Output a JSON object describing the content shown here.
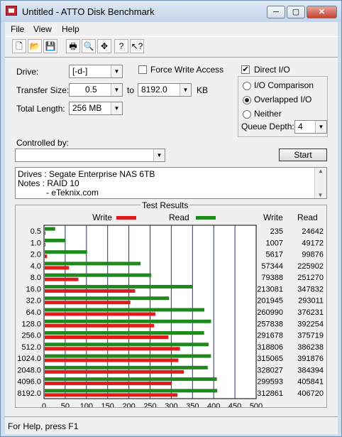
{
  "window": {
    "title": "Untitled - ATTO Disk Benchmark",
    "min": "─",
    "max": "▢",
    "close": "✕"
  },
  "menu": [
    "File",
    "View",
    "Help"
  ],
  "toolbar_icons": [
    "new-icon",
    "open-icon",
    "save-icon",
    "print-icon",
    "print-preview-icon",
    "move-icon",
    "help-icon",
    "context-help-icon"
  ],
  "form": {
    "drive_label": "Drive:",
    "drive_value": "[-d-]",
    "force_write_label": "Force Write Access",
    "force_write_checked": false,
    "direct_io_label": "Direct I/O",
    "direct_io_checked": true,
    "transfer_size_label": "Transfer Size:",
    "transfer_from": "0.5",
    "to_label": "to",
    "transfer_to": "8192.0",
    "unit": "KB",
    "total_length_label": "Total Length:",
    "total_length": "256 MB",
    "radio_io_comparison": "I/O Comparison",
    "radio_overlapped": "Overlapped I/O",
    "radio_neither": "Neither",
    "selected_radio": "overlapped",
    "queue_depth_label": "Queue Depth:",
    "queue_depth": "4",
    "controlled_by_label": "Controlled by:",
    "controlled_by": "",
    "start_label": "Start"
  },
  "notes": {
    "line1": "Drives :  Segate Enterprise NAS 6TB",
    "line2": "Notes :   RAID 10",
    "line3": "            - eTeknix.com"
  },
  "results_title": "Test Results",
  "chart_data": {
    "type": "bar",
    "categories": [
      "0.5",
      "1.0",
      "2.0",
      "4.0",
      "8.0",
      "16.0",
      "32.0",
      "64.0",
      "128.0",
      "256.0",
      "512.0",
      "1024.0",
      "2048.0",
      "4096.0",
      "8192.0"
    ],
    "series": [
      {
        "name": "Write",
        "color": "#e01b1b",
        "values": [
          235,
          1007,
          5617,
          57344,
          79388,
          213081,
          201945,
          260990,
          257838,
          291678,
          318806,
          315065,
          328027,
          299593,
          312861
        ]
      },
      {
        "name": "Read",
        "color": "#1e8a1e",
        "values": [
          24642,
          49172,
          99876,
          225902,
          251270,
          347832,
          293011,
          376231,
          392254,
          375719,
          386238,
          391876,
          384394,
          405841,
          406720
        ]
      }
    ],
    "xlabel": "Transfer Rate - MB / Sec",
    "xlim": [
      0,
      500
    ],
    "xticks": [
      "0",
      "50",
      "100",
      "150",
      "200",
      "250",
      "300",
      "350",
      "400",
      "450",
      "500"
    ],
    "value_units_per_mb": 1000,
    "write_col_label": "Write",
    "read_col_label": "Read"
  },
  "status": "For Help, press F1"
}
